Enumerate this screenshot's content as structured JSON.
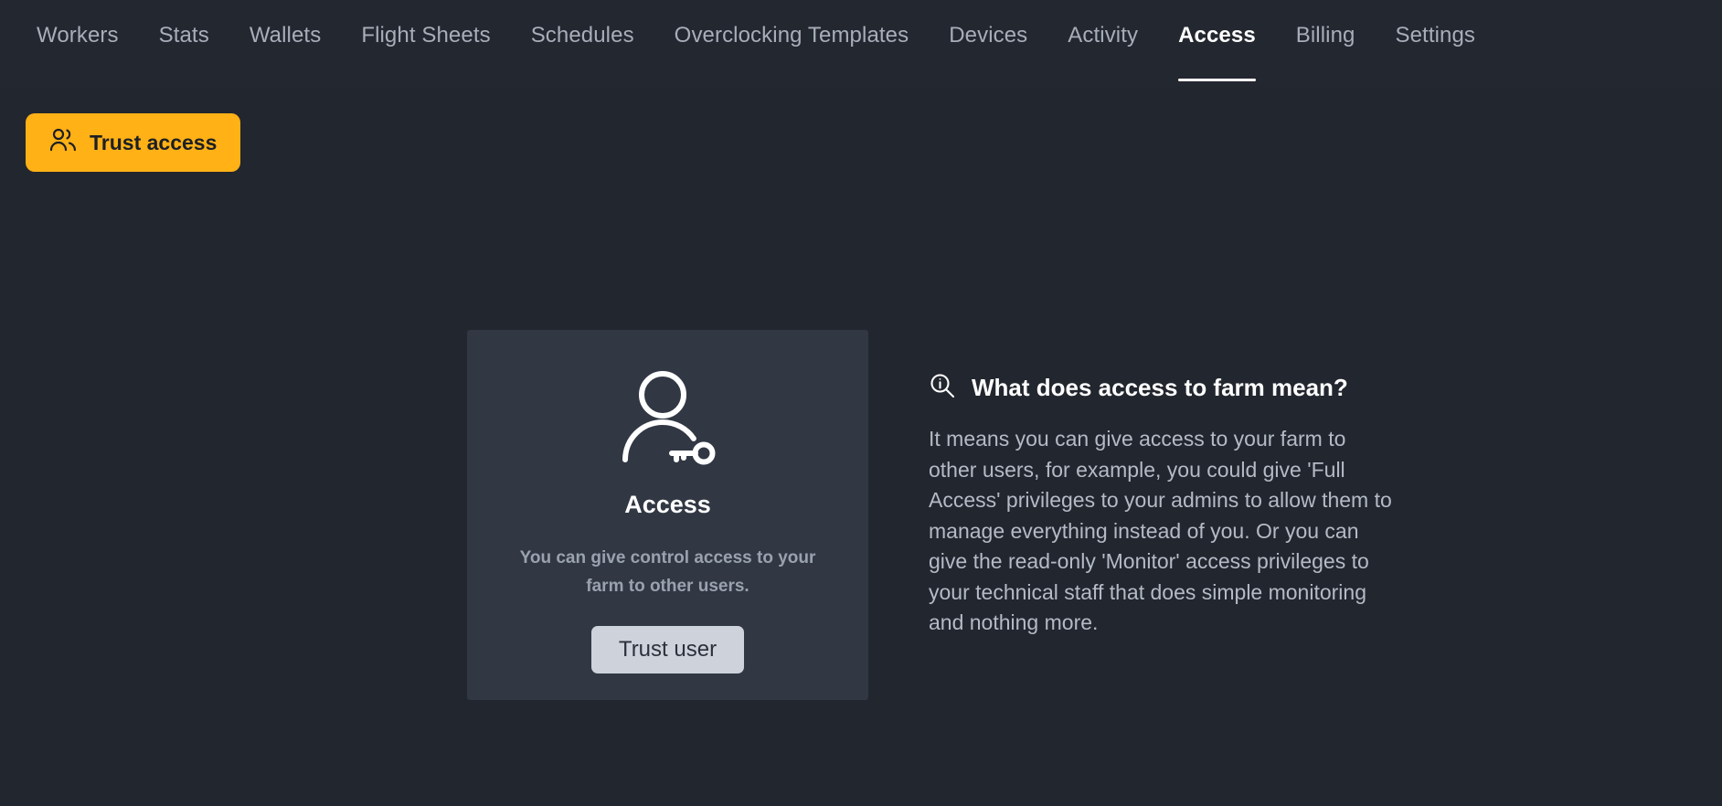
{
  "nav": {
    "items": [
      {
        "label": "Workers",
        "active": false
      },
      {
        "label": "Stats",
        "active": false
      },
      {
        "label": "Wallets",
        "active": false
      },
      {
        "label": "Flight Sheets",
        "active": false
      },
      {
        "label": "Schedules",
        "active": false
      },
      {
        "label": "Overclocking Templates",
        "active": false
      },
      {
        "label": "Devices",
        "active": false
      },
      {
        "label": "Activity",
        "active": false
      },
      {
        "label": "Access",
        "active": true
      },
      {
        "label": "Billing",
        "active": false
      },
      {
        "label": "Settings",
        "active": false
      }
    ]
  },
  "toolbar": {
    "trust_access_label": "Trust access",
    "trust_access_icon": "users-icon"
  },
  "card": {
    "icon": "user-key-icon",
    "title": "Access",
    "description": "You can give control access to your farm to other users.",
    "button_label": "Trust user"
  },
  "info": {
    "icon": "info-magnifier-icon",
    "title": "What does access to farm mean?",
    "body": "It means you can give access to your farm to other users, for example, you could give 'Full Access' privileges to your admins to allow them to manage everything instead of you. Or you can give the read-only 'Monitor' access privileges to your technical staff that does simple monitoring and nothing more."
  },
  "colors": {
    "accent": "#ffb116",
    "nav_background": "#23272f",
    "content_background": "#22262e",
    "card_background": "#313843",
    "button_light": "#ced2da",
    "text_primary": "#ffffff",
    "text_muted": "#a7aeb9"
  }
}
